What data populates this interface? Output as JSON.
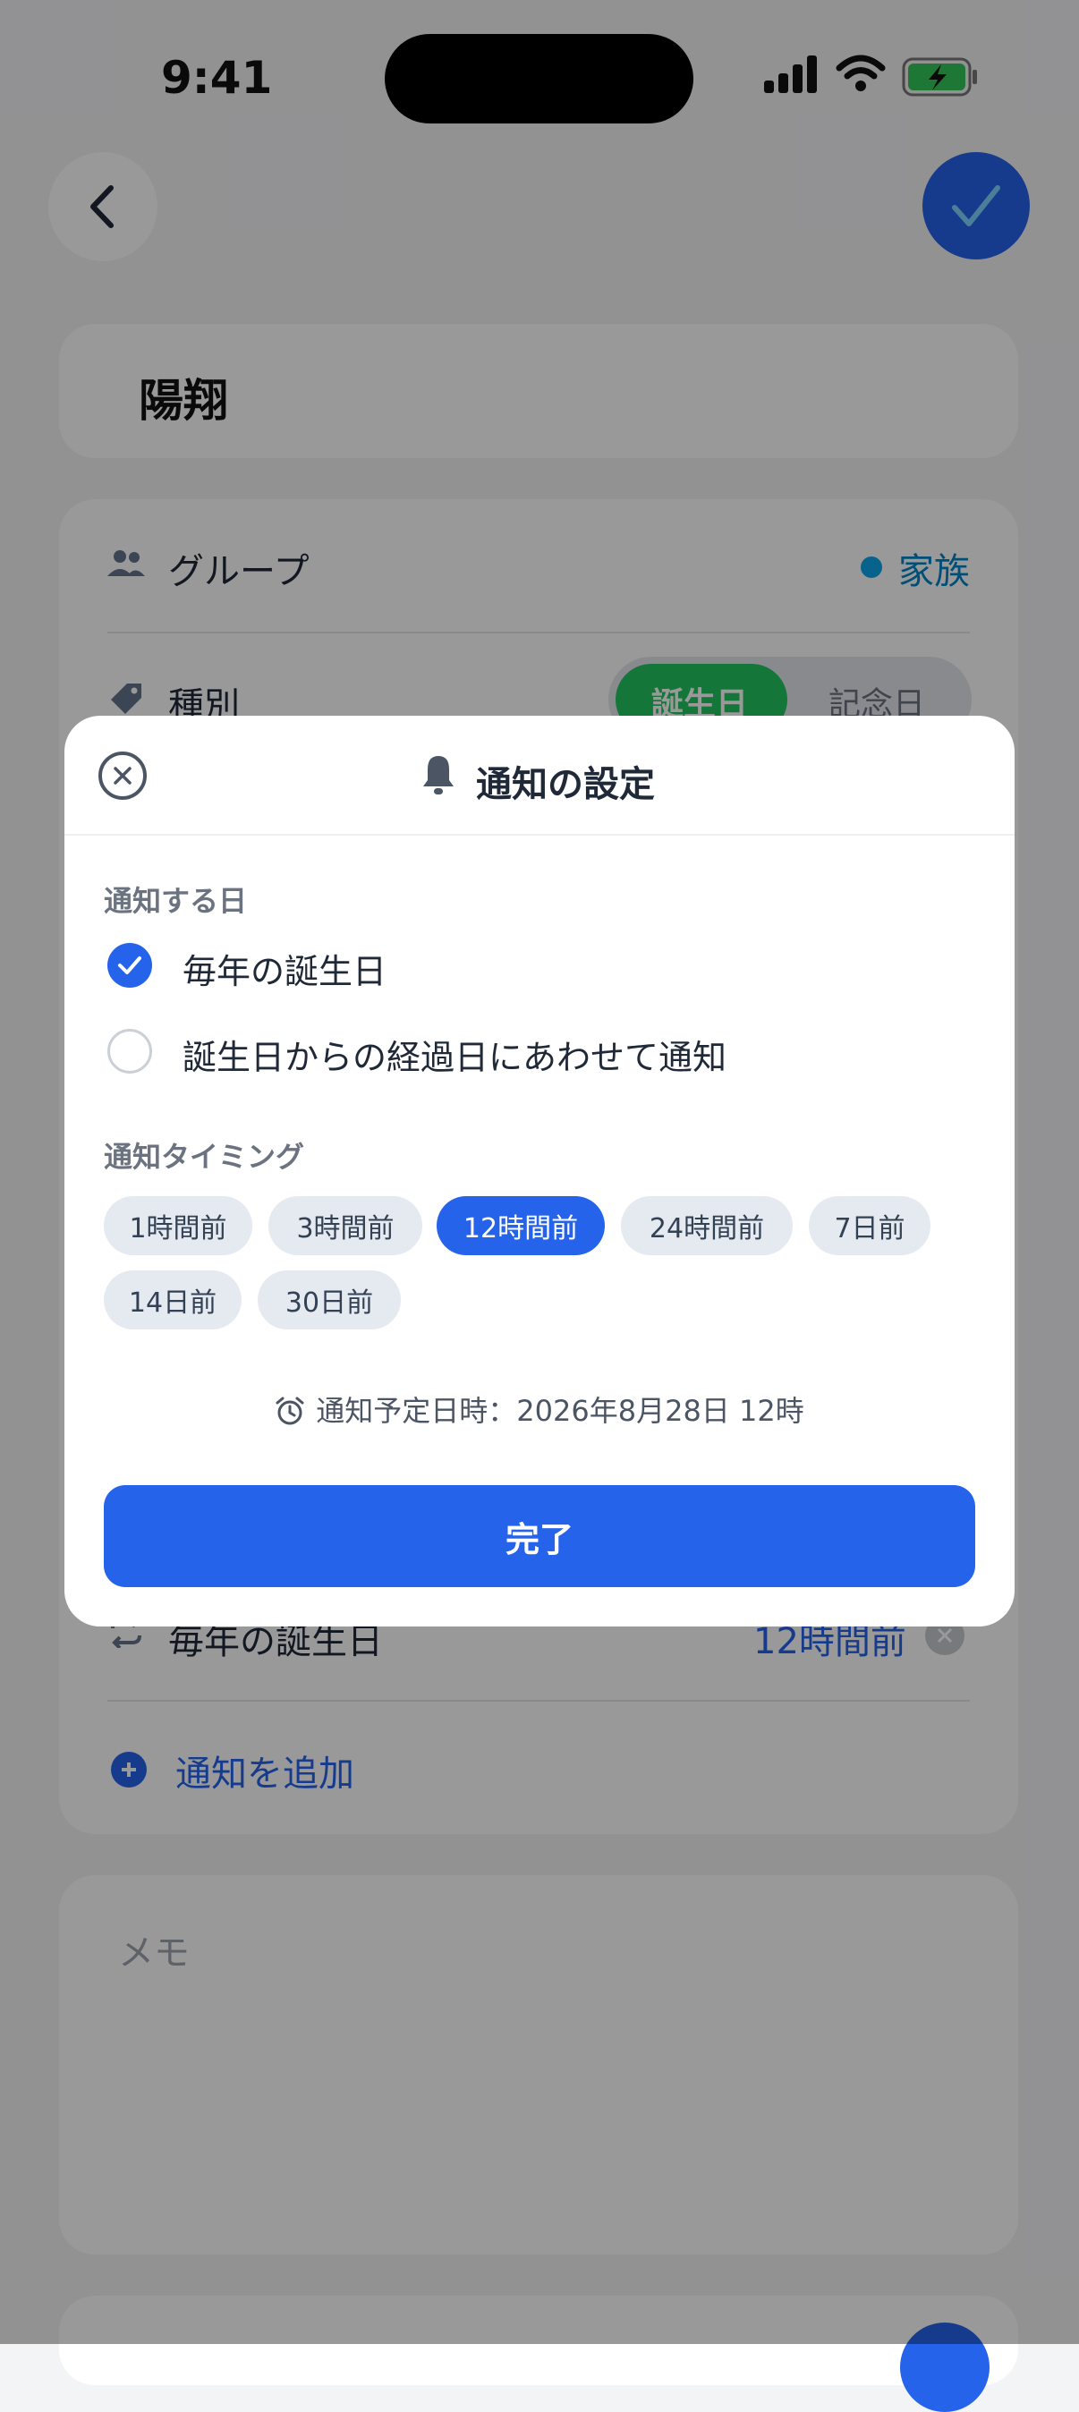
{
  "status_bar": {
    "time": "9:41"
  },
  "form": {
    "name": "陽翔",
    "group_label": "グループ",
    "group_value": "家族",
    "type_label": "種別",
    "type_options": [
      "誕生日",
      "記念日"
    ],
    "type_selected": "誕生日",
    "notification_row": {
      "label": "毎年の誕生日",
      "timing": "12時間前"
    },
    "add_notification": "通知を追加",
    "memo_placeholder": "メモ"
  },
  "modal": {
    "title": "通知の設定",
    "notify_day_label": "通知する日",
    "options": [
      {
        "label": "毎年の誕生日",
        "checked": true
      },
      {
        "label": "誕生日からの経過日にあわせて通知",
        "checked": false
      }
    ],
    "timing_label": "通知タイミング",
    "chips": [
      {
        "label": "1時間前",
        "selected": false
      },
      {
        "label": "3時間前",
        "selected": false
      },
      {
        "label": "12時間前",
        "selected": true
      },
      {
        "label": "24時間前",
        "selected": false
      },
      {
        "label": "7日前",
        "selected": false
      },
      {
        "label": "14日前",
        "selected": false
      },
      {
        "label": "30日前",
        "selected": false
      }
    ],
    "schedule_text": "通知予定日時：2026年8月28日 12時",
    "done_label": "完了"
  },
  "colors": {
    "accent": "#2563eb",
    "green": "#22c55e",
    "group_dot": "#0ea5e9"
  },
  "icons": [
    "back-icon",
    "check-icon",
    "group-icon",
    "tag-icon",
    "repeat-icon",
    "remove-icon",
    "add-icon",
    "close-icon",
    "bell-icon",
    "alarm-clock-icon"
  ]
}
